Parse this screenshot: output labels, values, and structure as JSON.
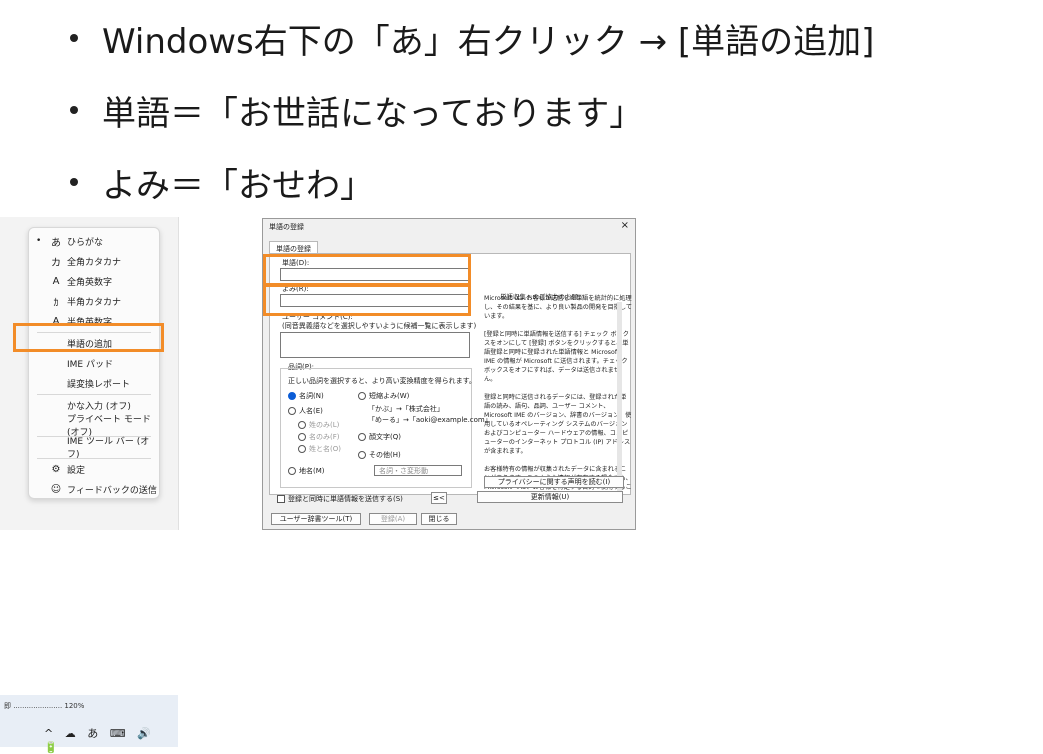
{
  "bullets": [
    {
      "text": "Windows右下の「あ」右クリック → [単語の追加]"
    },
    {
      "text": "単語＝「お世話になっております」"
    },
    {
      "text": "よみ＝「おせわ」"
    }
  ],
  "context_menu": {
    "items": [
      {
        "icon": "あ",
        "label": "ひらがな",
        "checked": "•"
      },
      {
        "icon": "カ",
        "label": "全角カタカナ"
      },
      {
        "icon": "A",
        "label": "全角英数字"
      },
      {
        "icon": "ｶ",
        "label": "半角カタカナ"
      },
      {
        "icon": "A",
        "label": "半角英数字"
      },
      {
        "label": "単語の追加"
      },
      {
        "label": "IME パッド"
      },
      {
        "label": "誤変換レポート"
      },
      {
        "label": "かな入力 (オフ)"
      },
      {
        "label": "プライベート モード (オフ)"
      },
      {
        "label": "IME ツール バー (オフ)"
      },
      {
        "icon": "⚙",
        "label": "設定"
      },
      {
        "icon": "☺",
        "label": "フィードバックの送信"
      }
    ],
    "taskbar_row1": "即 ...................... 120%",
    "taskbar_row2": "^ ☁ あ ⌨ 🔊 🔋"
  },
  "dialog": {
    "title": "単語の登録",
    "close": "×",
    "tab": "単語の登録",
    "word_label": "単語(D):",
    "reading_label": "よみ(R):",
    "comment_label": "ユーザー コメント(C):",
    "comment_hint": "(同音異義語などを選択しやすいように候補一覧に表示します)",
    "pos_group_label": "品詞(P):",
    "pos_hint": "正しい品詞を選択すると、より高い変換精度を得られます。",
    "radios": {
      "noun": "名詞(N)",
      "person": "人名(E)",
      "person_last": "姓のみ(L)",
      "person_first": "名のみ(F)",
      "person_full": "姓と名(O)",
      "place": "地名(M)",
      "abbrev": "短縮よみ(W)",
      "abbrev_ex1": "「かぶ」→「株式会社」",
      "abbrev_ex2": "「めーる」→「aoki@example.com」",
      "emoticon": "顔文字(Q)",
      "other": "その他(H)"
    },
    "other_select": "名詞・さ変形動",
    "checkbox_label": "登録と同時に単語情報を送信する(S)",
    "small_button": "≤<",
    "notice_title": "単語収集へのご協力のお願い",
    "notice_text": "Microsoft は、お客様が送信した単語を統計的に処理し、その結果を基に、より良い製品の開発を目指しています。\n\n[登録と同時に単語情報を送信する] チェック ボックスをオンにして [登録] ボタンをクリックすると、単語登録と同時に登録された単語情報と Microsoft IME の情報が Microsoft に送信されます。チェック ボックスをオフにすれば、データは送信されません。\n\n登録と同時に送信されるデータには、登録された単語の読み、語句、品詞、ユーザー コメント、Microsoft IME のバージョン、辞書のバージョン、使用しているオペレーティング システムのバージョンおよびコンピューター ハードウェアの情報、コンピューターのインターネット プロトコル (IP) アドレスが含まれます。\n\nお客様特有の情報が収集されたデータに含まれることがあります。このような情報が存在する場合でも、Microsoft では、お客様を特定する目的で使用することはありません。",
    "privacy_button": "プライバシーに関する声明を読む(I)",
    "update_button": "更新情報(U)",
    "user_dict_button": "ユーザー辞書ツール(T)",
    "register_button": "登録(A)",
    "close_button": "閉じる"
  }
}
